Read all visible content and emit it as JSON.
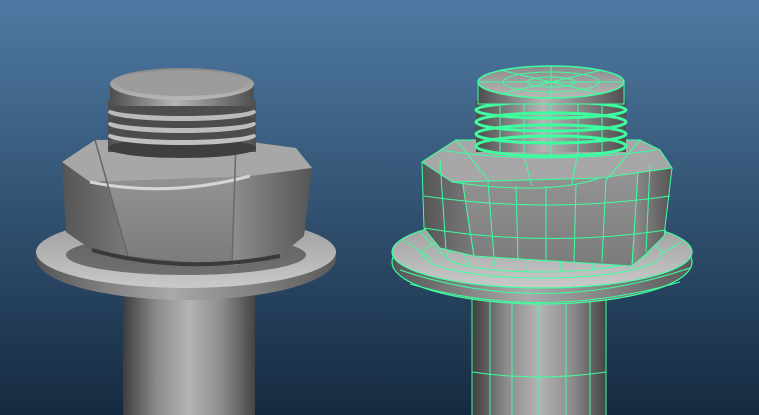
{
  "viewport": {
    "background_top": "#4f7aa3",
    "background_bottom": "#152a40",
    "objects": [
      {
        "name": "bolt-nut-washer",
        "display": "shaded"
      },
      {
        "name": "bolt-nut-washer",
        "display": "shaded-wireframe-selected"
      }
    ],
    "colors": {
      "shade_light": "#c9c9c9",
      "shade_mid": "#8e8e8e",
      "shade_dark": "#4a4a4a",
      "wire_selected": "#3dffa0"
    }
  }
}
